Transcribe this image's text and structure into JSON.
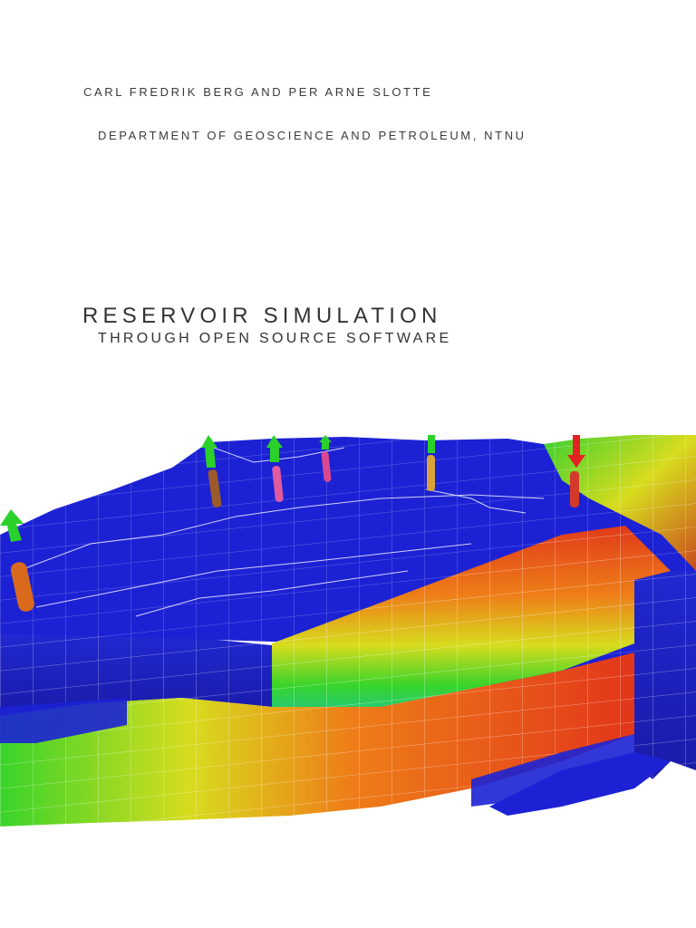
{
  "cover": {
    "authors": "Carl Fredrik Berg and Per Arne Slotte",
    "department": "Department of Geoscience and Petroleum, NTNU",
    "title": "Reservoir Simulation",
    "subtitle": "through open source software"
  },
  "figure": {
    "kind": "3D reservoir grid rendering with wells",
    "colors": {
      "low": "#1e1ec8",
      "mid_low": "#17c5a0",
      "mid": "#39d42a",
      "mid_high": "#d8dc1e",
      "high_orange": "#ee7e18",
      "high": "#e2361a",
      "grid_line": "#ffffff"
    },
    "wells": [
      {
        "id": "well-1",
        "head": "green",
        "tube": "#d96a1c"
      },
      {
        "id": "well-2",
        "head": "green",
        "tube": "#9a5a2a"
      },
      {
        "id": "well-3",
        "head": "green",
        "tube": "#e05aa0"
      },
      {
        "id": "well-4",
        "head": "green",
        "tube": "#d8478f"
      },
      {
        "id": "well-5",
        "head": "green",
        "tube": "#d9a23a"
      },
      {
        "id": "well-6",
        "head": "red",
        "tube": "#d33a2a"
      }
    ]
  }
}
